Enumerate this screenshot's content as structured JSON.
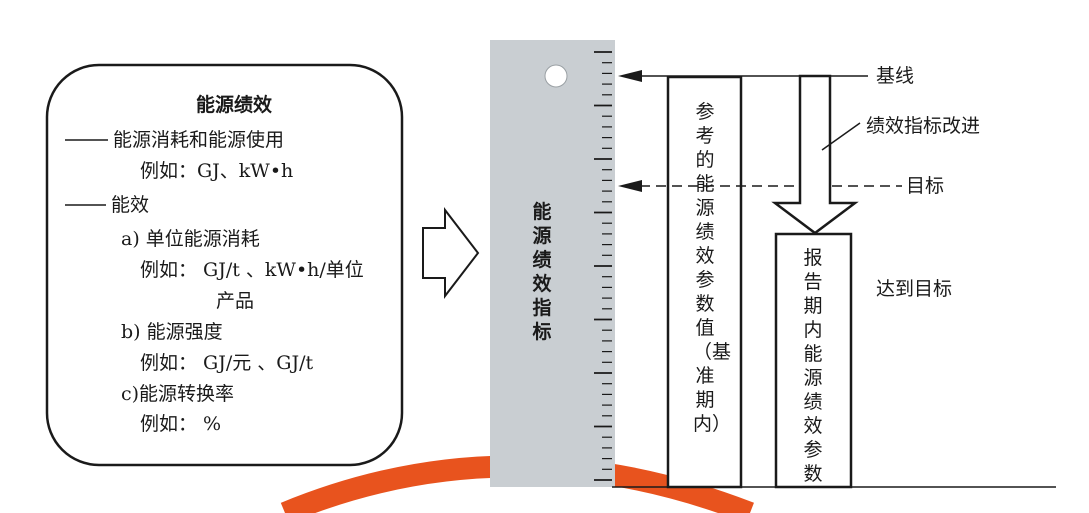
{
  "left_box": {
    "title": "能源绩效",
    "item1": "能源消耗和能源使用",
    "item1_example": "例如：GJ、kW•h",
    "item2": "能效",
    "a_label": "a) 单位能源消耗",
    "a_example_1": "例如： GJ/t 、kW•h/单位",
    "a_example_2": "产品",
    "b_label": "b) 能源强度",
    "b_example": "例如： GJ/元 、GJ/t",
    "c_label": "c)能源转换率",
    "c_example": "例如： %"
  },
  "ruler": {
    "label": "能源绩效指标"
  },
  "baseline_bar": {
    "label": "参考的能源绩效参数值（基准期内）"
  },
  "report_bar": {
    "label": "报告期内能源绩效参数"
  },
  "annotations": {
    "baseline": "基线",
    "improvement": "绩效指标改进",
    "target": "目标",
    "reached": "达到目标"
  },
  "colors": {
    "ruler_fill": "#c9ced2",
    "arc_color": "#e8531e",
    "line_color": "#1a1a1a"
  }
}
